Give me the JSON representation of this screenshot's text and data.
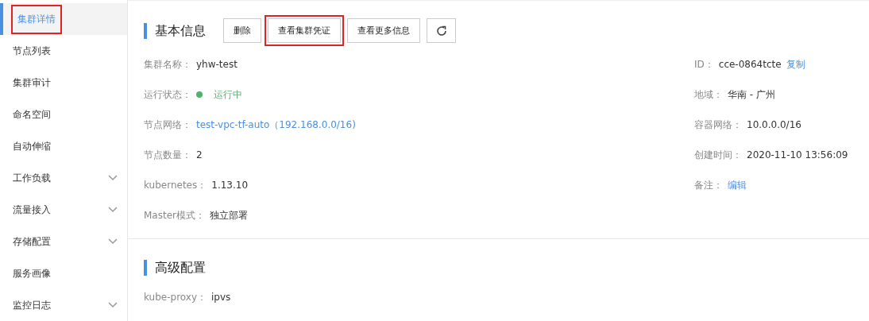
{
  "sidebar": {
    "items": [
      {
        "label": "集群详情",
        "selected": true,
        "expandable": false,
        "highlighted": true
      },
      {
        "label": "节点列表",
        "selected": false,
        "expandable": false,
        "highlighted": false
      },
      {
        "label": "集群审计",
        "selected": false,
        "expandable": false,
        "highlighted": false
      },
      {
        "label": "命名空间",
        "selected": false,
        "expandable": false,
        "highlighted": false
      },
      {
        "label": "自动伸缩",
        "selected": false,
        "expandable": false,
        "highlighted": false
      },
      {
        "label": "工作负载",
        "selected": false,
        "expandable": true,
        "highlighted": false
      },
      {
        "label": "流量接入",
        "selected": false,
        "expandable": true,
        "highlighted": false
      },
      {
        "label": "存储配置",
        "selected": false,
        "expandable": true,
        "highlighted": false
      },
      {
        "label": "服务画像",
        "selected": false,
        "expandable": false,
        "highlighted": false
      },
      {
        "label": "监控日志",
        "selected": false,
        "expandable": true,
        "highlighted": false
      }
    ]
  },
  "basic_info": {
    "title": "基本信息",
    "buttons": [
      {
        "kind": "text",
        "label": "删除",
        "highlighted": false
      },
      {
        "kind": "text",
        "label": "查看集群凭证",
        "highlighted": true
      },
      {
        "kind": "text",
        "label": "查看更多信息",
        "highlighted": false
      },
      {
        "kind": "refresh",
        "highlighted": false
      }
    ],
    "left_fields": [
      {
        "label": "集群名称：",
        "parts": [
          {
            "kind": "text",
            "text": "yhw-test"
          }
        ]
      },
      {
        "label": "运行状态：",
        "parts": [
          {
            "kind": "status",
            "text": "运行中",
            "color": "#52b36b"
          }
        ]
      },
      {
        "label": "节点网络：",
        "parts": [
          {
            "kind": "link",
            "text": "test-vpc-tf-auto（192.168.0.0/16)"
          }
        ]
      },
      {
        "label": "节点数量：",
        "parts": [
          {
            "kind": "text",
            "text": "2"
          }
        ]
      },
      {
        "label": "kubernetes：",
        "parts": [
          {
            "kind": "text",
            "text": "1.13.10"
          }
        ]
      },
      {
        "label": "Master模式：",
        "parts": [
          {
            "kind": "text",
            "text": "独立部署"
          }
        ]
      }
    ],
    "right_fields": [
      {
        "label": "ID：",
        "parts": [
          {
            "kind": "text",
            "text": "cce-0864tcte"
          },
          {
            "kind": "link",
            "text": "复制"
          }
        ]
      },
      {
        "label": "地域：",
        "parts": [
          {
            "kind": "text",
            "text": "华南 - 广州"
          }
        ]
      },
      {
        "label": "容器网络：",
        "parts": [
          {
            "kind": "text",
            "text": "10.0.0.0/16"
          }
        ]
      },
      {
        "label": "创建时间：",
        "parts": [
          {
            "kind": "text",
            "text": "2020-11-10 13:56:09"
          }
        ]
      },
      {
        "label": "备注：",
        "parts": [
          {
            "kind": "link",
            "text": "编辑"
          }
        ]
      }
    ]
  },
  "advanced_config": {
    "title": "高级配置",
    "fields": [
      {
        "label": "kube-proxy：",
        "parts": [
          {
            "kind": "text",
            "text": "ipvs"
          }
        ]
      }
    ]
  }
}
